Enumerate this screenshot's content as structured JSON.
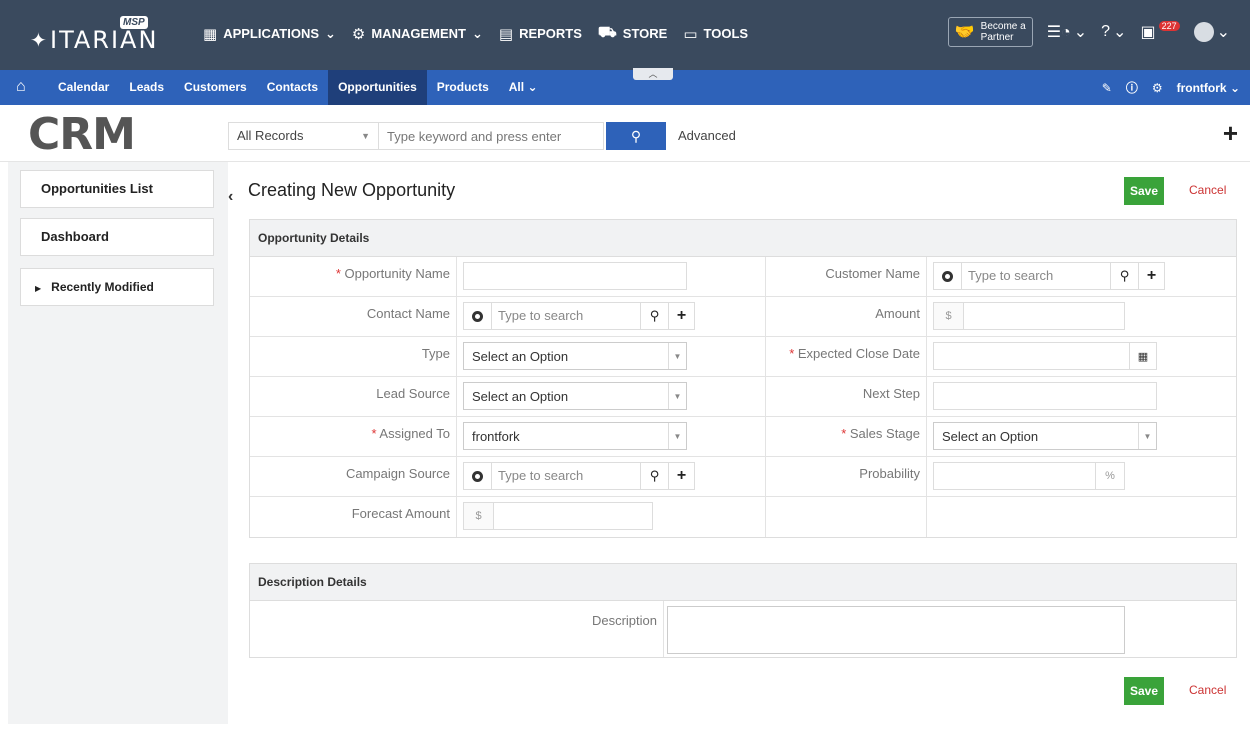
{
  "brand": {
    "logo_text": "ITARIAN",
    "logo_badge": "MSP",
    "module_logo": "CRM"
  },
  "topnav": [
    {
      "label": "APPLICATIONS",
      "icon": "grid-icon",
      "caret": true
    },
    {
      "label": "MANAGEMENT",
      "icon": "gears-icon",
      "caret": true
    },
    {
      "label": "REPORTS",
      "icon": "report-icon",
      "caret": false
    },
    {
      "label": "STORE",
      "icon": "cart-icon",
      "caret": false
    },
    {
      "label": "TOOLS",
      "icon": "toolbox-icon",
      "caret": false
    }
  ],
  "topright": {
    "partner_line1": "Become a",
    "partner_line2": "Partner",
    "notification_count": "227"
  },
  "navbar": {
    "links": [
      "Calendar",
      "Leads",
      "Customers",
      "Contacts",
      "Opportunities",
      "Products",
      "All"
    ],
    "active": "Opportunities",
    "user": "frontfork"
  },
  "search": {
    "records_label": "All Records",
    "placeholder": "Type keyword and press enter",
    "advanced_label": "Advanced"
  },
  "sidebar": {
    "items": [
      "Opportunities List",
      "Dashboard"
    ],
    "recent_label": "Recently Modified"
  },
  "page": {
    "title": "Creating New Opportunity",
    "save_label": "Save",
    "cancel_label": "Cancel"
  },
  "opportunity": {
    "section_title": "Opportunity Details",
    "fields": {
      "opportunity_name": "Opportunity Name",
      "customer_name": "Customer Name",
      "contact_name": "Contact Name",
      "amount": "Amount",
      "type": "Type",
      "expected_close_date": "Expected Close Date",
      "lead_source": "Lead Source",
      "next_step": "Next Step",
      "assigned_to": "Assigned To",
      "sales_stage": "Sales Stage",
      "campaign_source": "Campaign Source",
      "probability": "Probability",
      "forecast_amount": "Forecast Amount"
    },
    "values": {
      "type": "Select an Option",
      "lead_source": "Select an Option",
      "assigned_to": "frontfork",
      "sales_stage": "Select an Option"
    },
    "lookup_placeholder": "Type to search",
    "currency_symbol": "$",
    "percent_symbol": "%",
    "required_mark": "*"
  },
  "description": {
    "section_title": "Description Details",
    "label": "Description"
  }
}
